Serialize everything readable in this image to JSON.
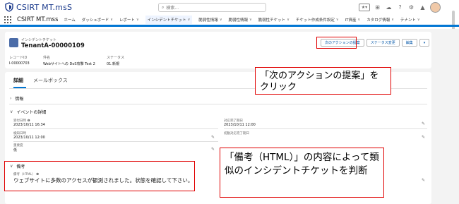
{
  "app": {
    "logo_text": "CSIRT MT.msS",
    "name": "CSIRT MT.mss"
  },
  "search": {
    "placeholder": "検索..."
  },
  "nav": [
    "ホーム",
    "ダッシュボード",
    "レポート",
    "インシデントチケット",
    "脆弱性情報",
    "脆弱性情報",
    "脆弱性チケット",
    "チケット作成条件設定",
    "IT資産",
    "カタログ情報",
    "テナント"
  ],
  "record": {
    "type": "インシデントチケット",
    "title": "TenantA-00000109",
    "actions": [
      "次のアクションの提案",
      "ステータス変更",
      "編集"
    ],
    "fields": [
      {
        "label": "レコードID",
        "value": "I-00000703"
      },
      {
        "label": "件名",
        "value": "Webサイトへの DoS攻撃 Test 2"
      },
      {
        "label": "ステータス",
        "value": "01.新規"
      }
    ]
  },
  "tabs": [
    "詳細",
    "メールボックス"
  ],
  "sections": {
    "info": "情報",
    "event": "イベントの詳細",
    "remarks": "備考"
  },
  "event_fields": {
    "received_label": "受付日時",
    "received_value": "2023/10/11 16:34",
    "detected_label": "検知日時",
    "detected_value": "2023/10/11 12:00",
    "severity_label": "重要度",
    "severity_value": "低",
    "target_label": "対応完了期日",
    "target_value": "2023/10/11 12:00",
    "first_label": "初動対応完了期日"
  },
  "remarks": {
    "label": "備考（HTML）",
    "text": "ウェブサイトに多数のアクセスが観測されました。状態を確認して下さい。"
  },
  "callouts": {
    "top": "「次のアクションの提案」をクリック",
    "bottom": "「備考（HTML）」の内容によって類似のインシデントチケットを判断"
  },
  "colors": {
    "accent": "#0176d3",
    "callout": "#e00000"
  }
}
